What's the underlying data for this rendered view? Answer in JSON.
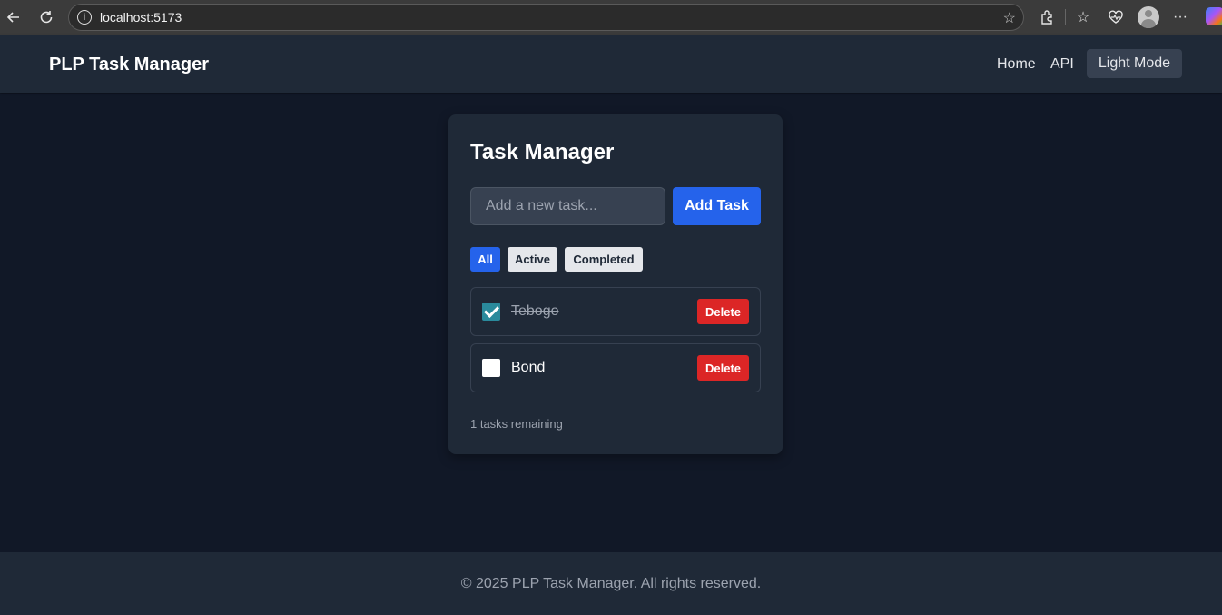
{
  "browser": {
    "url": "localhost:5173"
  },
  "navbar": {
    "brand": "PLP Task Manager",
    "links": [
      "Home",
      "API"
    ],
    "theme_toggle": "Light Mode"
  },
  "card": {
    "title": "Task Manager",
    "input_placeholder": "Add a new task...",
    "input_value": "",
    "add_button": "Add Task",
    "filters": [
      {
        "label": "All",
        "selected": true
      },
      {
        "label": "Active",
        "selected": false
      },
      {
        "label": "Completed",
        "selected": false
      }
    ],
    "tasks": [
      {
        "text": "Tebogo",
        "completed": true,
        "delete_label": "Delete"
      },
      {
        "text": "Bond",
        "completed": false,
        "delete_label": "Delete"
      }
    ],
    "remaining": "1 tasks remaining"
  },
  "footer": {
    "text": "© 2025 PLP Task Manager. All rights reserved."
  },
  "colors": {
    "page_bg": "#111827",
    "panel_bg": "#1f2937",
    "primary": "#2563eb",
    "danger": "#dc2626",
    "checkbox_checked": "#2a8a9c"
  }
}
